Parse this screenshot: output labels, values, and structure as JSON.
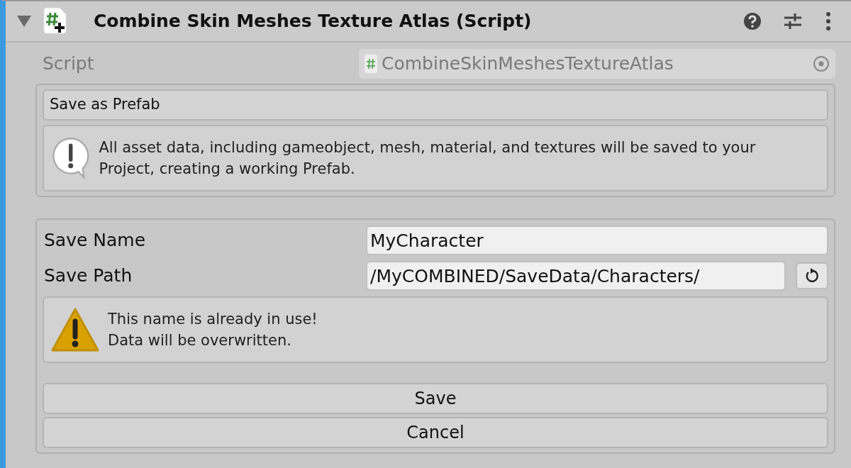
{
  "component": {
    "title": "Combine Skin Meshes Texture Atlas (Script)",
    "expanded": true
  },
  "script_field": {
    "label": "Script",
    "value": "CombineSkinMeshesTextureAtlas",
    "disabled": true
  },
  "prefab_section": {
    "button": "Save as Prefab",
    "message": {
      "kind": "info",
      "text": "All asset data, including gameobject, mesh, material, and textures will be saved to your Project, creating a working Prefab."
    }
  },
  "save_section": {
    "fields": [
      {
        "label": "Save Name",
        "value": "MyCharacter",
        "reset": false
      },
      {
        "label": "Save Path",
        "value": "/MyCOMBINED/SaveData/Characters/",
        "reset": true
      }
    ],
    "message": {
      "kind": "warning",
      "lines": [
        "This name is already in use!",
        "Data will be overwritten."
      ]
    },
    "buttons": [
      "Save",
      "Cancel"
    ]
  }
}
